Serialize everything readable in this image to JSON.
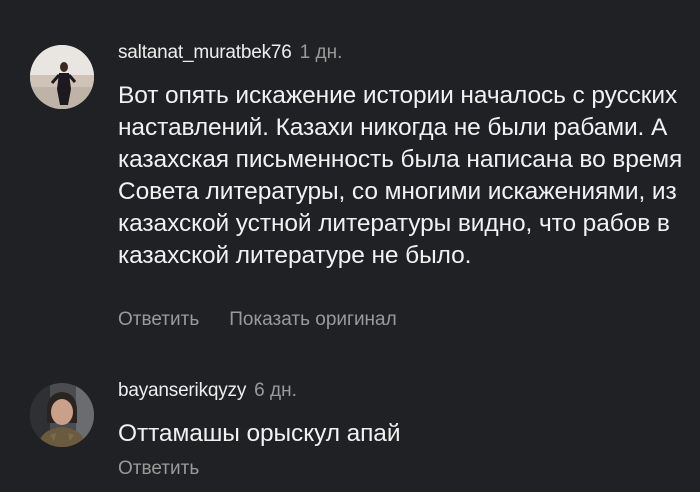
{
  "comments": [
    {
      "username": "saltanat_muratbek76",
      "time": "1 дн.",
      "text": "Вот опять искажение истории началось с русских наставлений. Казахи никогда не были рабами. А казахская письменность была написана во время Совета литературы, со многими искажениями, из казахской устной литературы видно, что рабов в казахской литературе не было.",
      "reply_label": "Ответить",
      "show_original_label": "Показать оригинал"
    },
    {
      "username": "bayanserikqyzy",
      "time": "6 дн.",
      "text": "Оттамашы орыскул апай",
      "reply_label": "Ответить"
    }
  ],
  "colors": {
    "background": "#202124",
    "primary_text": "#f1f1f1",
    "secondary_text": "#9a9a9a"
  }
}
